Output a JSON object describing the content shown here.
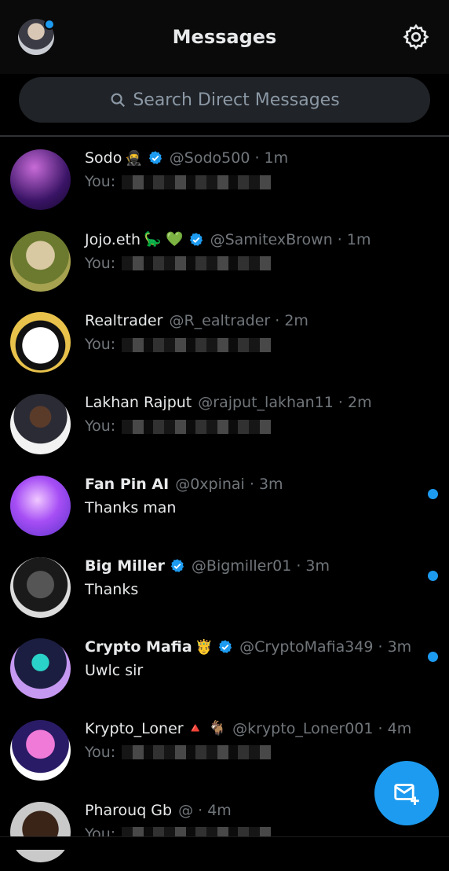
{
  "header": {
    "title": "Messages",
    "profile_icon": "user-avatar",
    "settings_icon": "gear-icon",
    "notification_dot_color": "#1d9bf0"
  },
  "search": {
    "placeholder": "Search Direct Messages",
    "icon": "search-icon"
  },
  "accent_color": "#1d9bf0",
  "conversations": [
    {
      "name": "Sodo",
      "emoji": "🥷",
      "verified": true,
      "handle": "@Sodo500",
      "time": "1m",
      "preview": "You:",
      "unread": false
    },
    {
      "name": "Jojo.eth",
      "emoji": "🦕 💚",
      "verified": true,
      "handle": "@SamitexBrown",
      "time": "1m",
      "preview": "You:",
      "unread": false
    },
    {
      "name": "Realtrader",
      "emoji": "",
      "verified": false,
      "handle": "@R_ealtrader",
      "time": "2m",
      "preview": "You:",
      "unread": false
    },
    {
      "name": "Lakhan Rajput",
      "emoji": "",
      "verified": false,
      "handle": "@rajput_lakhan11",
      "time": "2m",
      "preview": "You:",
      "unread": false
    },
    {
      "name": "Fan Pin AI",
      "emoji": "",
      "verified": false,
      "handle": "@0xpinai",
      "time": "3m",
      "preview": "Thanks man",
      "unread": true
    },
    {
      "name": "Big Miller",
      "emoji": "",
      "verified": true,
      "handle": "@Bigmiller01",
      "time": "3m",
      "preview": "Thanks",
      "unread": true
    },
    {
      "name": "Crypto Mafia",
      "emoji": "🤴",
      "verified": true,
      "handle": "@CryptoMafia349",
      "time": "3m",
      "preview": "Uwlc sir",
      "unread": true
    },
    {
      "name": "Krypto_Loner",
      "emoji": "🔺 🐐",
      "verified": false,
      "handle": "@krypto_Loner001",
      "time": "4m",
      "preview": "You:",
      "unread": false
    },
    {
      "name": "Pharouq Gb",
      "emoji": "",
      "verified": false,
      "handle": "@",
      "time": "4m",
      "preview": "You:",
      "unread": false
    }
  ],
  "fab": {
    "icon": "new-message-icon"
  }
}
